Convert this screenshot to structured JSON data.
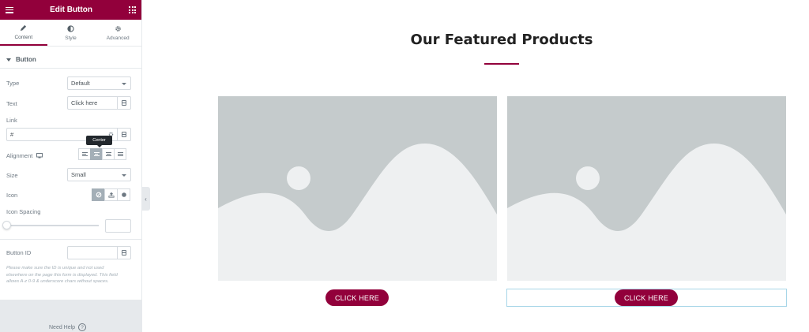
{
  "panel": {
    "title": "Edit Button",
    "tabs": [
      {
        "label": "Content",
        "icon": "pencil-icon",
        "active": true
      },
      {
        "label": "Style",
        "icon": "contrast-icon",
        "active": false
      },
      {
        "label": "Advanced",
        "icon": "gear-icon",
        "active": false
      }
    ],
    "section_title": "Button",
    "type": {
      "label": "Type",
      "value": "Default"
    },
    "text": {
      "label": "Text",
      "value": "Click here"
    },
    "link": {
      "label": "Link",
      "value": "#"
    },
    "alignment": {
      "label": "Alignment",
      "tooltip": "Center",
      "options": [
        "Left",
        "Center",
        "Right",
        "Justified"
      ],
      "selected": "Center"
    },
    "size": {
      "label": "Size",
      "value": "Small"
    },
    "icon": {
      "label": "Icon",
      "options": [
        "none-icon",
        "upload-icon",
        "solid-circle-icon"
      ],
      "selected": "none-icon"
    },
    "icon_spacing": {
      "label": "Icon Spacing",
      "value": ""
    },
    "button_id": {
      "label": "Button ID",
      "value": ""
    },
    "help_text": "Please make sure the ID is unique and not used elsewhere on the page this form is displayed. This field allows A-z 0-9 & underscore chars without spaces.",
    "need_help": "Need Help",
    "accent_color": "#92003b"
  },
  "canvas": {
    "heading": "Our Featured Products",
    "products": [
      {
        "button_label": "CLICK HERE",
        "image": "placeholder-image"
      },
      {
        "button_label": "CLICK HERE",
        "image": "placeholder-image"
      }
    ]
  }
}
